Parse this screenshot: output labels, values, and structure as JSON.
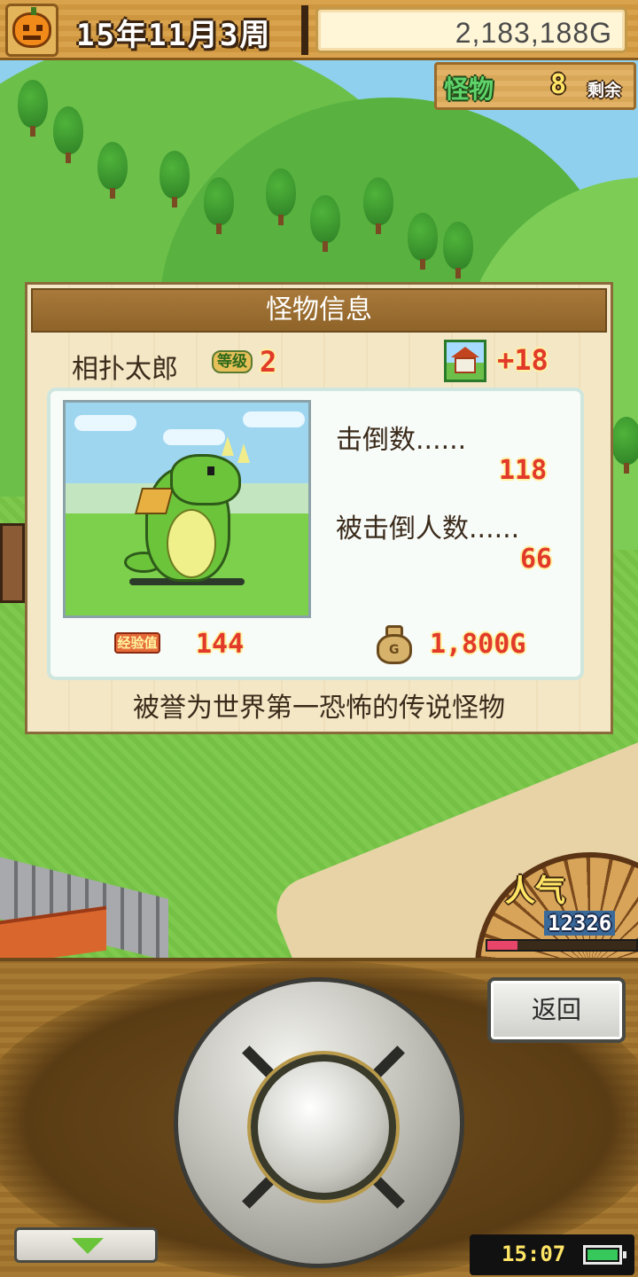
{
  "header": {
    "date_text": "15年11月3周",
    "money": "2,183,188G"
  },
  "monster_counter": {
    "label": "怪物",
    "value": "8",
    "suffix": "剩余"
  },
  "info_panel": {
    "title": "怪物信息",
    "monster_name": "相扑太郎",
    "level_label": "等级",
    "level_value": "2",
    "town_bonus": "+18",
    "defeated_label": "击倒数......",
    "defeated_value": "118",
    "knocked_out_label": "被击倒人数......",
    "knocked_out_value": "66",
    "exp_label": "经验值",
    "exp_value": "144",
    "reward_value": "1,800G",
    "description": "被誉为世界第一恐怖的传说怪物"
  },
  "popularity": {
    "label": "人气",
    "value": "12326",
    "bar_fill_fraction": 0.2,
    "bar_color": "#e8456a"
  },
  "controls": {
    "back_label": "返回",
    "clock": "15:07",
    "battery_level": 0.85
  },
  "icons": [
    "pumpkin-icon",
    "town-icon",
    "money-bag-icon",
    "down-arrow-icon",
    "battery-icon"
  ]
}
